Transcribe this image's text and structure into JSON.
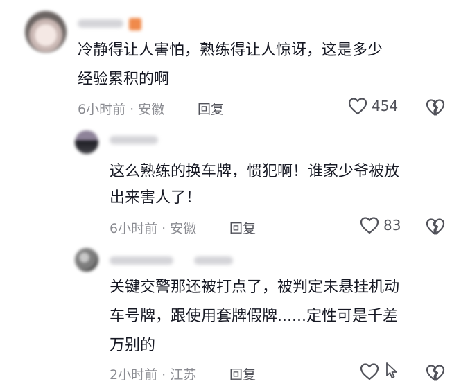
{
  "comments": [
    {
      "text_lines": [
        "冷静得让人害怕，熟练得让人惊讶，这是多少",
        "经验累积的啊"
      ],
      "time_location": "6小时前 · 安徽",
      "reply_label": "回复",
      "like_count": "454"
    },
    {
      "text_lines": [
        "这么熟练的换车牌，惯犯啊！谁家少爷被放",
        "出来害人了！"
      ],
      "time_location": "6小时前 · 安徽",
      "reply_label": "回复",
      "like_count": "83"
    },
    {
      "text_lines": [
        "关键交警那还被打点了，被判定未悬挂机动",
        "车号牌，跟使用套牌假牌......定性可是千差",
        "万别的"
      ],
      "time_location": "2小时前 · 江苏",
      "reply_label": "回复",
      "like_count": ""
    }
  ],
  "icons": {
    "like": "heart-outline-icon",
    "dislike": "broken-heart-icon",
    "cursor": "mouse-cursor-icon"
  },
  "colors": {
    "text": "#161823",
    "meta": "#8a8b91",
    "icon": "#51525a"
  }
}
